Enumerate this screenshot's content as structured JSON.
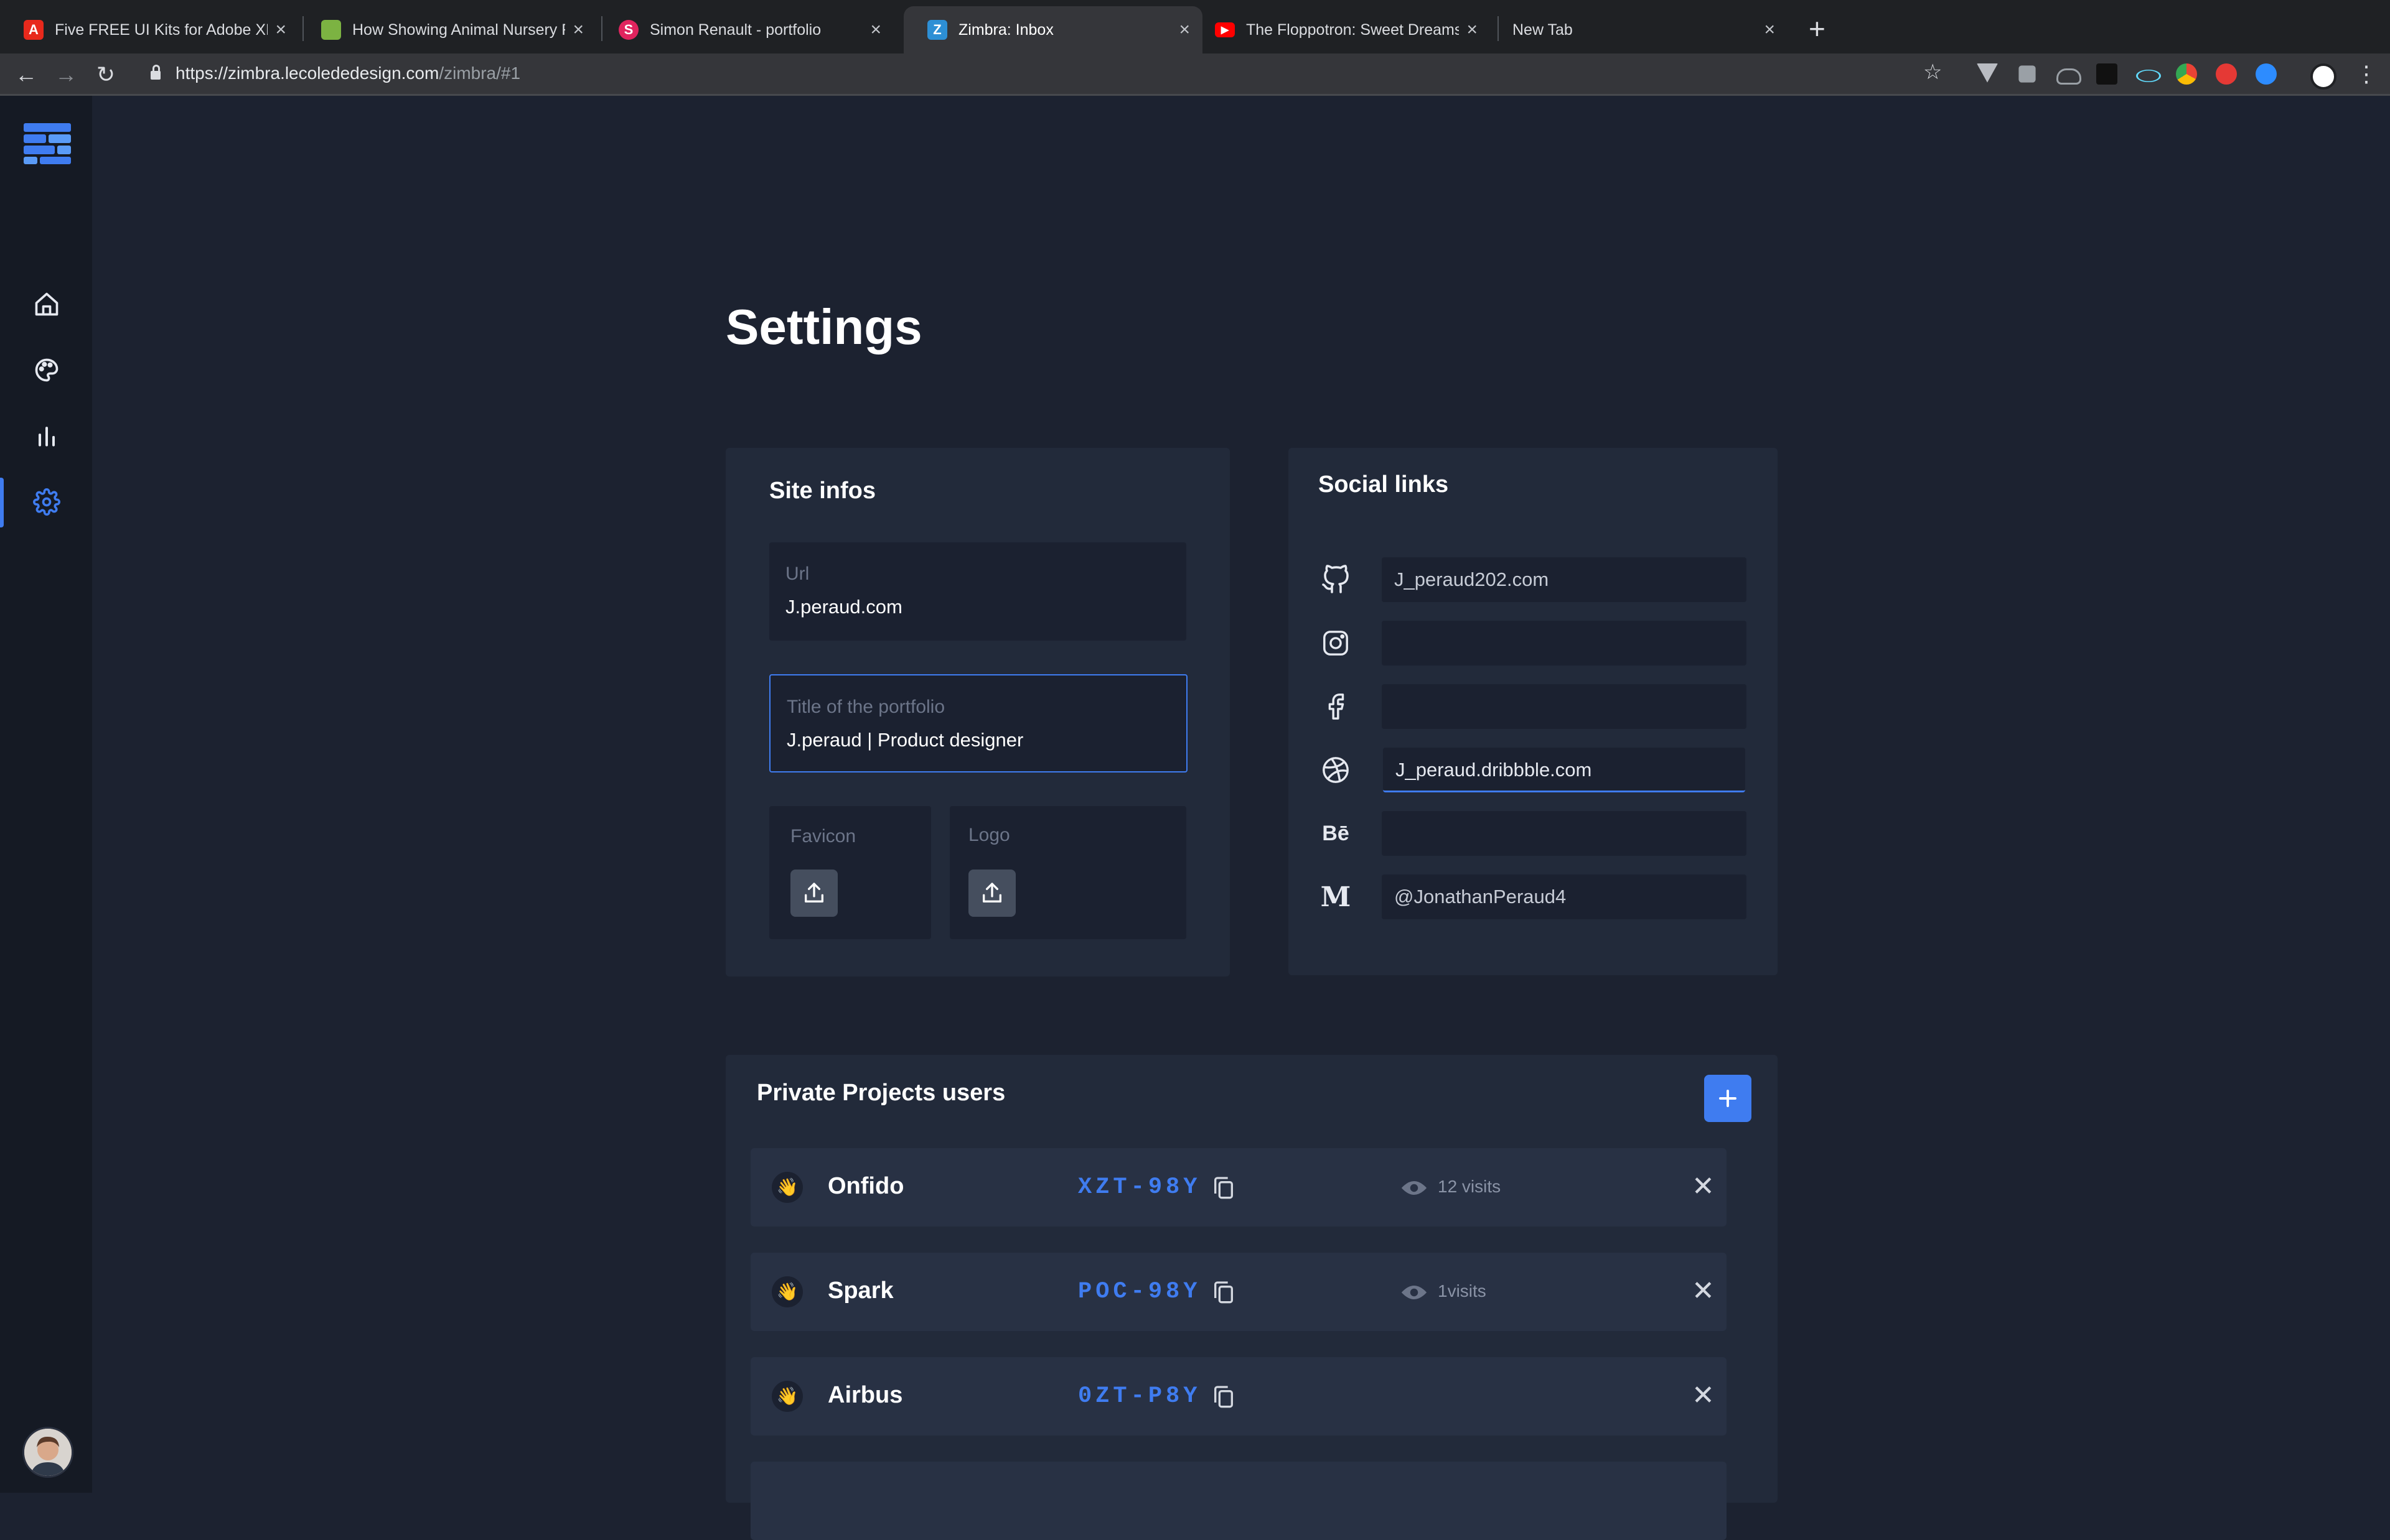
{
  "browser": {
    "tabs": [
      {
        "title": "Five FREE UI Kits for Adobe XD",
        "icon": "adobe-icon",
        "color": "#e8291c",
        "glyph": "A"
      },
      {
        "title": "How Showing Animal Nursery R",
        "icon": "nursery-icon",
        "color": "#7cb342",
        "glyph": ""
      },
      {
        "title": "Simon Renault - portfolio",
        "icon": "portfolio-icon",
        "color": "#e0245e",
        "glyph": "S"
      },
      {
        "title": "Zimbra: Inbox",
        "icon": "zimbra-icon",
        "color": "#2d8fd5",
        "glyph": "Z"
      },
      {
        "title": "The Floppotron: Sweet Dreams",
        "icon": "youtube-icon",
        "color": "#ff0000",
        "glyph": "▶"
      },
      {
        "title": "New Tab",
        "icon": "",
        "color": "",
        "glyph": ""
      }
    ],
    "url_host": "https://zimbra.lecolededesign.com",
    "url_path": "/zimbra/#1"
  },
  "settings": {
    "title": "Settings",
    "site_infos": {
      "heading": "Site infos",
      "url_label": "Url",
      "url_value": "J.peraud.com",
      "portfolio_title_label": "Title of the portfolio",
      "portfolio_title_value": "J.peraud | Product designer",
      "favicon_label": "Favicon",
      "logo_label": "Logo"
    },
    "social_links": {
      "heading": "Social links",
      "items": [
        {
          "icon": "github-icon",
          "value": ""
        },
        {
          "icon": "instagram-icon",
          "value": ""
        },
        {
          "icon": "facebook-icon",
          "value": ""
        },
        {
          "icon": "dribbble-icon",
          "value": ""
        },
        {
          "icon": "behance-icon",
          "value": "",
          "glyph": "Bē"
        },
        {
          "icon": "medium-icon",
          "value": "",
          "glyph": "M"
        }
      ],
      "github_value": "J_peraud202.com",
      "dribbble_value": "J_peraud.dribbble.com",
      "medium_value": "@JonathanPeraud4"
    },
    "private_projects": {
      "heading": "Private Projects users",
      "users": [
        {
          "name": "Onfido",
          "code": "XZT-98Y",
          "visits": "12 visits"
        },
        {
          "name": "Spark",
          "code": "POC-98Y",
          "visits": "1visits"
        },
        {
          "name": "Airbus",
          "code": "0ZT-P8Y",
          "visits": ""
        }
      ]
    }
  },
  "colors": {
    "accent": "#3f7cf0",
    "background": "#1c2230",
    "card": "#222a3a",
    "sidebar": "#151a24"
  }
}
